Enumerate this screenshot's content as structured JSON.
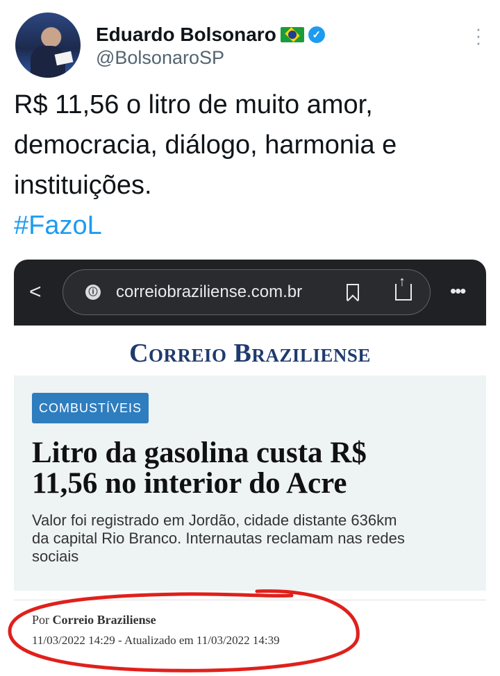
{
  "tweet": {
    "author_name": "Eduardo Bolsonaro",
    "handle": "@BolsonaroSP",
    "text_lines": [
      "R$ 11,56 o litro de muito amor,",
      "democracia, diálogo, harmonia e",
      "instituições."
    ],
    "hashtag": "#FazoL"
  },
  "browser": {
    "url": "correiobraziliense.com.br"
  },
  "article": {
    "masthead": "Correio Braziliense",
    "category": "COMBUSTÍVEIS",
    "headline_lines": [
      "Litro da gasolina custa R$",
      "11,56 no interior do Acre"
    ],
    "subtitle_lines": [
      "Valor foi registrado em Jordão, cidade distante 636km",
      "da capital Rio Branco. Internautas reclamam nas redes",
      "sociais"
    ],
    "byline_prefix": "Por",
    "byline_author": "Correio Braziliense",
    "dateline": "11/03/2022 14:29 - Atualizado em 11/03/2022 14:39"
  },
  "colors": {
    "verified": "#1d9bf0",
    "hashtag": "#1d9bf0",
    "badge": "#2e7dbf",
    "annotation": "#e0201b"
  },
  "icons": [
    "flag-icon",
    "verified-icon",
    "more-icon",
    "back-icon",
    "site-info-icon",
    "bookmark-icon",
    "share-icon",
    "menu-icon"
  ]
}
